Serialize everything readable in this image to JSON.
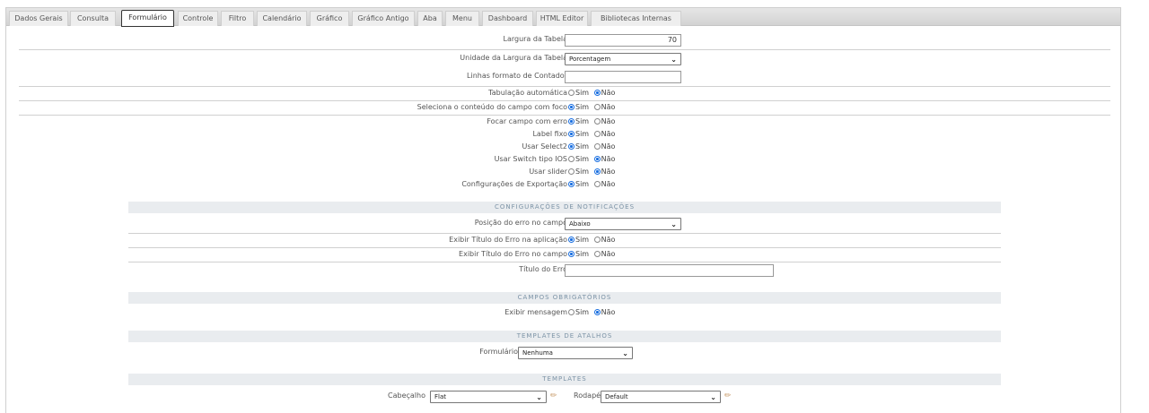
{
  "tabs": [
    {
      "label": "Dados Gerais",
      "active": false
    },
    {
      "label": "Consulta",
      "active": false
    },
    {
      "label": "Formulário",
      "active": true
    },
    {
      "label": "Controle",
      "active": false
    },
    {
      "label": "Filtro",
      "active": false
    },
    {
      "label": "Calendário",
      "active": false
    },
    {
      "label": "Gráfico",
      "active": false
    },
    {
      "label": "Gráfico Antigo",
      "active": false
    },
    {
      "label": "Aba",
      "active": false
    },
    {
      "label": "Menu",
      "active": false
    },
    {
      "label": "Dashboard",
      "active": false
    },
    {
      "label": "HTML Editor",
      "active": false
    },
    {
      "label": "Bibliotecas Internas",
      "active": false
    }
  ],
  "radio": {
    "yes": "Sim",
    "no": "Não"
  },
  "general": {
    "table_width_label": "Largura da Tabela",
    "table_width_value": "70",
    "width_unit_label": "Unidade da Largura da Tabela",
    "width_unit_value": "Porcentagem",
    "counter_lines_label": "Linhas formato de Contador",
    "counter_lines_value": "",
    "auto_tab_label": "Tabulação automática",
    "auto_tab_value": "no",
    "select_focus_label": "Seleciona o conteúdo do campo com foco",
    "select_focus_value": "yes",
    "focus_error_label": "Focar campo com erro",
    "focus_error_value": "yes",
    "label_fixed_label": "Label fixo",
    "label_fixed_value": "yes",
    "select2_label": "Usar Select2",
    "select2_value": "yes",
    "switch_ios_label": "Usar Switch tipo IOS",
    "switch_ios_value": "no",
    "slider_label": "Usar slider",
    "slider_value": "no",
    "export_config_label": "Configurações de Exportação",
    "export_config_value": "yes"
  },
  "notifications": {
    "header": "CONFIGURAÇÕES DE NOTIFICAÇÕES",
    "error_position_label": "Posição do erro no campo",
    "error_position_value": "Abaixo",
    "show_title_app_label": "Exibir Título do Erro na aplicação",
    "show_title_app_value": "yes",
    "show_title_field_label": "Exibir Título do Erro no campo",
    "show_title_field_value": "yes",
    "error_title_label": "Título do Erro",
    "error_title_value": ""
  },
  "required": {
    "header": "CAMPOS OBRIGATÓRIOS",
    "show_message_label": "Exibir mensagem",
    "show_message_value": "no"
  },
  "shortcuts": {
    "header": "TEMPLATES DE ATALHOS",
    "form_label": "Formulário",
    "form_value": "Nenhuma"
  },
  "templates": {
    "header": "TEMPLATES",
    "header_label": "Cabeçalho",
    "header_value": "Flat",
    "footer_label": "Rodapé",
    "footer_value": "Default"
  },
  "colors": {
    "accent": "#1a6fe0",
    "section_bg": "#e9ecef",
    "section_text": "#7c93a6"
  }
}
